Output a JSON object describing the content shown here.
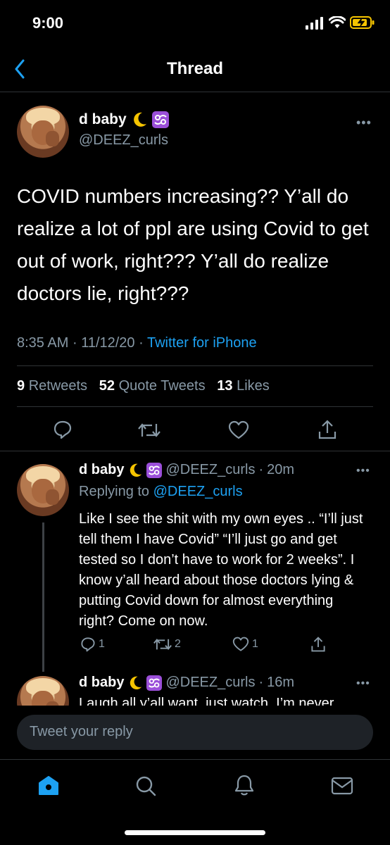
{
  "status_bar": {
    "time": "9:00"
  },
  "nav": {
    "title": "Thread"
  },
  "main_tweet": {
    "display_name": "d baby",
    "handle": "@DEEZ_curls",
    "text": "COVID numbers increasing?? Y’all do realize a lot of ppl are using Covid to get out of work, right??? Y’all do realize doctors lie, right???",
    "time": "8:35 AM",
    "date": "11/12/20",
    "separator": "·",
    "source": "Twitter for iPhone",
    "retweets_count": "9",
    "retweets_label": "Retweets",
    "quotes_count": "52",
    "quotes_label": "Quote Tweets",
    "likes_count": "13",
    "likes_label": "Likes"
  },
  "reply_1": {
    "display_name": "d baby",
    "handle": "@DEEZ_curls",
    "time": "20m",
    "replying_to_label": "Replying to",
    "replying_to_handle": "@DEEZ_curls",
    "text": "Like I see the shit with my own eyes .. “I’ll just tell them I have Covid” “I’ll just go and get tested so I don’t have to work for 2 weeks”. I know y’all heard about those doctors lying & putting Covid down for almost everything right? Come on now.",
    "reply_count": "1",
    "retweet_count": "2",
    "like_count": "1"
  },
  "reply_2": {
    "display_name": "d baby",
    "handle": "@DEEZ_curls",
    "time": "16m",
    "text": "Laugh all y’all want, just watch. I’m never"
  },
  "compose": {
    "placeholder": "Tweet your reply"
  },
  "icons": {
    "moon": "crescent-moon-icon",
    "zodiac": "cancer-zodiac-icon",
    "home": "home-icon",
    "search": "search-icon",
    "notifications": "bell-icon",
    "messages": "envelope-icon"
  },
  "colors": {
    "accent": "#1da1f2",
    "muted": "#8899a6",
    "background": "#000000",
    "zodiac_badge": "#9b4fd9",
    "battery": "#f5c400"
  }
}
